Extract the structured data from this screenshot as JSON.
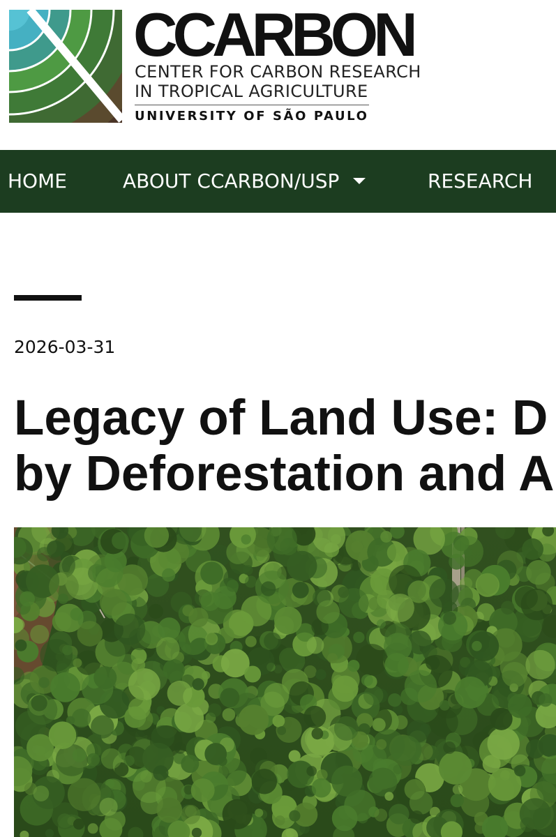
{
  "logo": {
    "title": "CCARBON",
    "subtitle_line1": "CENTER FOR CARBON RESEARCH",
    "subtitle_line2": "IN TROPICAL AGRICULTURE",
    "university": "UNIVERSITY OF SÃO PAULO",
    "icon": "ccarbon-logo-mark"
  },
  "nav": {
    "items": [
      {
        "label": "HOME"
      },
      {
        "label": "ABOUT CCARBON/USP",
        "has_dropdown": true,
        "icon": "caret-down-icon"
      },
      {
        "label": "RESEARCH"
      }
    ],
    "background_color": "#1c3d20"
  },
  "article": {
    "date": "2026-03-31",
    "title_line1": "Legacy of Land Use: D",
    "title_line2": "by Deforestation and A",
    "image_subject": "tropical-forest-canopy"
  },
  "colors": {
    "nav_green": "#1c3d20",
    "text": "#111111",
    "logo_teal": "#45b8c8",
    "logo_green": "#3f7a37",
    "logo_brown": "#4a3426"
  }
}
